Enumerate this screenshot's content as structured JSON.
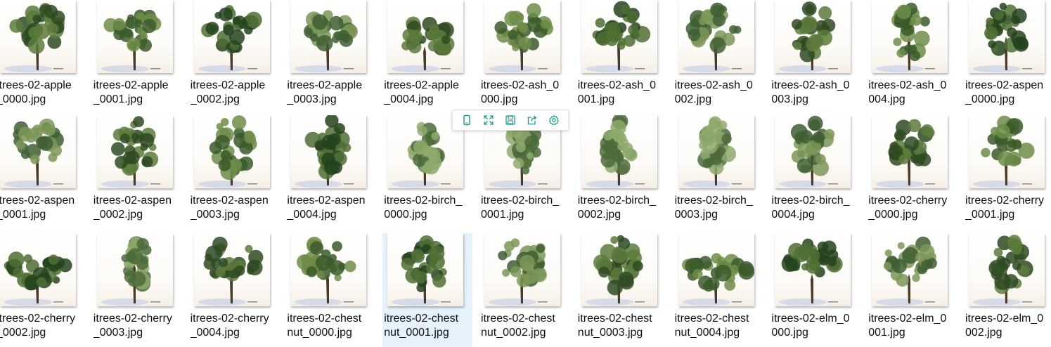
{
  "accent_color": "#1a9a8a",
  "selection_color": "#e5f1fb",
  "files": [
    {
      "name": "itrees-02-apple\n_0000.jpg",
      "tree": "apple",
      "shape": "round"
    },
    {
      "name": "itrees-02-apple\n_0001.jpg",
      "tree": "apple",
      "shape": "round"
    },
    {
      "name": "itrees-02-apple\n_0002.jpg",
      "tree": "apple",
      "shape": "round"
    },
    {
      "name": "itrees-02-apple\n_0003.jpg",
      "tree": "apple",
      "shape": "round"
    },
    {
      "name": "itrees-02-apple\n_0004.jpg",
      "tree": "apple",
      "shape": "wide"
    },
    {
      "name": "itrees-02-ash_0\n000.jpg",
      "tree": "ash",
      "shape": "round"
    },
    {
      "name": "itrees-02-ash_0\n001.jpg",
      "tree": "ash",
      "shape": "round"
    },
    {
      "name": "itrees-02-ash_0\n002.jpg",
      "tree": "ash",
      "shape": "round"
    },
    {
      "name": "itrees-02-ash_0\n003.jpg",
      "tree": "ash",
      "shape": "tall"
    },
    {
      "name": "itrees-02-ash_0\n004.jpg",
      "tree": "ash",
      "shape": "tall"
    },
    {
      "name": "itrees-02-aspen\n_0000.jpg",
      "tree": "aspen",
      "shape": "tall"
    },
    {
      "name": "itrees-02-aspen\n_0001.jpg",
      "tree": "aspen",
      "shape": "round"
    },
    {
      "name": "itrees-02-aspen\n_0002.jpg",
      "tree": "aspen",
      "shape": "tall"
    },
    {
      "name": "itrees-02-aspen\n_0003.jpg",
      "tree": "aspen",
      "shape": "tall"
    },
    {
      "name": "itrees-02-aspen\n_0004.jpg",
      "tree": "aspen",
      "shape": "tall"
    },
    {
      "name": "itrees-02-birch_\n0000.jpg",
      "tree": "birch",
      "shape": "thin"
    },
    {
      "name": "itrees-02-birch_\n0001.jpg",
      "tree": "birch",
      "shape": "thin"
    },
    {
      "name": "itrees-02-birch_\n0002.jpg",
      "tree": "birch",
      "shape": "thin"
    },
    {
      "name": "itrees-02-birch_\n0003.jpg",
      "tree": "birch",
      "shape": "thin"
    },
    {
      "name": "itrees-02-birch_\n0004.jpg",
      "tree": "birch",
      "shape": "tall"
    },
    {
      "name": "itrees-02-cherry\n_0000.jpg",
      "tree": "cherry",
      "shape": "round"
    },
    {
      "name": "itrees-02-cherry\n_0001.jpg",
      "tree": "cherry",
      "shape": "round"
    },
    {
      "name": "itrees-02-cherry\n_0002.jpg",
      "tree": "cherry",
      "shape": "wide"
    },
    {
      "name": "itrees-02-cherry\n_0003.jpg",
      "tree": "cherry",
      "shape": "thin"
    },
    {
      "name": "itrees-02-cherry\n_0004.jpg",
      "tree": "cherry",
      "shape": "round"
    },
    {
      "name": "itrees-02-chest\nnut_0000.jpg",
      "tree": "chestnut",
      "shape": "round"
    },
    {
      "name": "itrees-02-chest\nnut_0001.jpg",
      "tree": "chestnut",
      "shape": "tall",
      "selected": true
    },
    {
      "name": "itrees-02-chest\nnut_0002.jpg",
      "tree": "chestnut",
      "shape": "round"
    },
    {
      "name": "itrees-02-chest\nnut_0003.jpg",
      "tree": "chestnut",
      "shape": "tall"
    },
    {
      "name": "itrees-02-chest\nnut_0004.jpg",
      "tree": "chestnut",
      "shape": "wide"
    },
    {
      "name": "itrees-02-elm_0\n000.jpg",
      "tree": "elm",
      "shape": "round"
    },
    {
      "name": "itrees-02-elm_0\n001.jpg",
      "tree": "elm",
      "shape": "round"
    },
    {
      "name": "itrees-02-elm_0\n002.jpg",
      "tree": "elm",
      "shape": "tall"
    }
  ],
  "toolbar": {
    "buttons": [
      {
        "icon": "phone-icon",
        "name": "send-to-device-button"
      },
      {
        "icon": "expand-icon",
        "name": "preview-button"
      },
      {
        "icon": "save-icon",
        "name": "save-button"
      },
      {
        "icon": "share-icon",
        "name": "share-button"
      },
      {
        "icon": "gear-icon",
        "name": "settings-button"
      }
    ]
  }
}
